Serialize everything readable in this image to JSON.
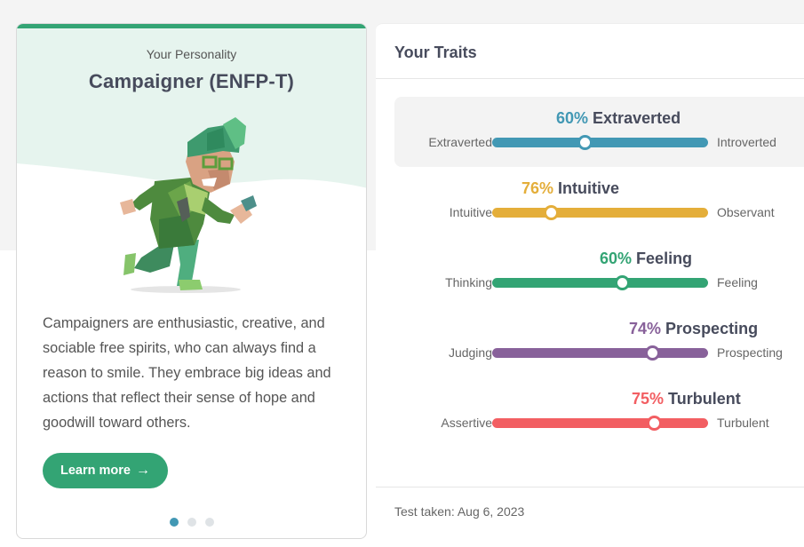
{
  "personality": {
    "subtitle": "Your Personality",
    "type": "Campaigner (ENFP-T)",
    "description": "Campaigners are enthusiastic, creative, and sociable free spirits, who can always find a reason to smile. They embrace big ideas and actions that reflect their sense of hope and goodwill toward others.",
    "learn_more": "Learn more",
    "learn_more_icon": "arrow-right-icon",
    "carousel_active": 0
  },
  "traits_panel": {
    "title": "Your Traits",
    "traits": [
      {
        "pct": "60%",
        "name": "Extraverted",
        "left": "Extraverted",
        "right": "Introverted",
        "value": 0.43,
        "color": "#4298b4",
        "highlight": true
      },
      {
        "pct": "76%",
        "name": "Intuitive",
        "left": "Intuitive",
        "right": "Observant",
        "value": 0.27,
        "color": "#e4ae3a",
        "highlight": false
      },
      {
        "pct": "60%",
        "name": "Feeling",
        "left": "Thinking",
        "right": "Feeling",
        "value": 0.6,
        "color": "#33a474",
        "highlight": false
      },
      {
        "pct": "74%",
        "name": "Prospecting",
        "left": "Judging",
        "right": "Prospecting",
        "value": 0.74,
        "color": "#88619a",
        "highlight": false
      },
      {
        "pct": "75%",
        "name": "Turbulent",
        "left": "Assertive",
        "right": "Turbulent",
        "value": 0.75,
        "color": "#f25e62",
        "highlight": false
      }
    ],
    "test_taken": "Test taken: Aug 6, 2023"
  },
  "colors": {
    "accent": "#33a474",
    "hero_bg": "#e6f4ee"
  }
}
